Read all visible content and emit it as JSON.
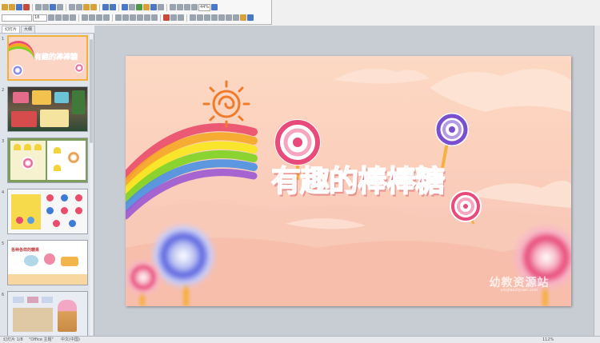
{
  "toolbar": {
    "font_size": "18",
    "zoom": "44%"
  },
  "thumb_pane": {
    "tabs": [
      "幻灯片",
      "大纲"
    ],
    "slides": [
      {
        "number": "1",
        "title": "有趣的棒棒糖"
      },
      {
        "number": "2"
      },
      {
        "number": "3"
      },
      {
        "number": "4"
      },
      {
        "number": "5",
        "title": "各种各样的糖果"
      },
      {
        "number": "6"
      }
    ]
  },
  "slide": {
    "title": "有趣的棒棒糖",
    "watermark": "幼教资源站",
    "watermark_url": "youjiaoziyuan.com"
  },
  "status_bar": {
    "slide_info": "幻灯片 1/8",
    "theme": "\"Office 主题\"",
    "language": "中文(中国)",
    "zoom": "112%"
  },
  "colors": {
    "title": "#e84a6a",
    "slide_bg": "#fcd9c4",
    "selection": "#f2b03c"
  }
}
